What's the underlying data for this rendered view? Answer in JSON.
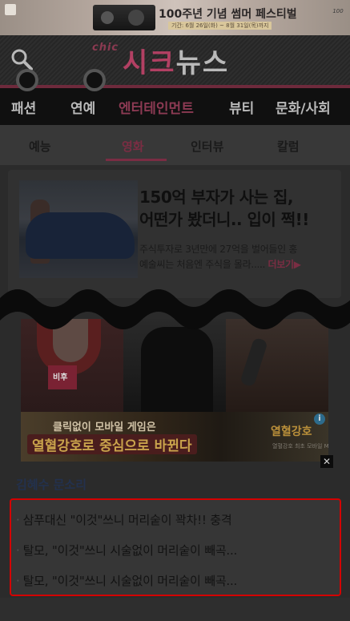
{
  "top_banner": {
    "title": "100주년 기념 썸머 페스티벌",
    "period": "기간: 6월 26일(화) ~ 8월 31일(목)까지",
    "badge": "100"
  },
  "header": {
    "logo_prefix": "chic",
    "logo_main": "시크",
    "logo_suffix": "뉴스"
  },
  "main_nav": [
    "패션",
    "연예",
    "엔터테인먼트",
    "뷰티",
    "문화/사회"
  ],
  "main_nav_active": "엔터테인먼트",
  "sub_tabs": [
    "예능",
    "영화",
    "인터뷰",
    "칼럼"
  ],
  "sub_tab_active": "영화",
  "article_card": {
    "title_line1": "150억 부자가 사는 집,",
    "title_line2": "어떤가 봤더니.. 입이 쩍!!",
    "desc_line1": "주식투자로 3년만에 27억을 벌어들인 홍",
    "desc_line2": "예술씨는 처음엔 주식을 몰라.....",
    "more_label": "더보기▶"
  },
  "photo_strip": {
    "sign_text": "비후"
  },
  "ad": {
    "line1": "클릭없이 모바일 게임은",
    "line2": "열혈강호로 중심으로 바뀐다",
    "brand": "열혈강호",
    "sub": "열혈강호 최초 모바일 MMORPG",
    "info_label": "i",
    "close_label": "✕"
  },
  "caption": "김혜수 문소리",
  "related_items": [
    "삼푸대신 \"이것\"쓰니 머리숱이 꽉차!! 충격",
    "탈모, \"이것\"쓰니 시술없이 머리숱이 빼곡...",
    "탈모, \"이것\"쓰니 시술없이 머리숱이 빼곡..."
  ],
  "colors": {
    "brand": "#b24063",
    "nav_active": "#8c3a53",
    "related_border": "#d40000"
  }
}
